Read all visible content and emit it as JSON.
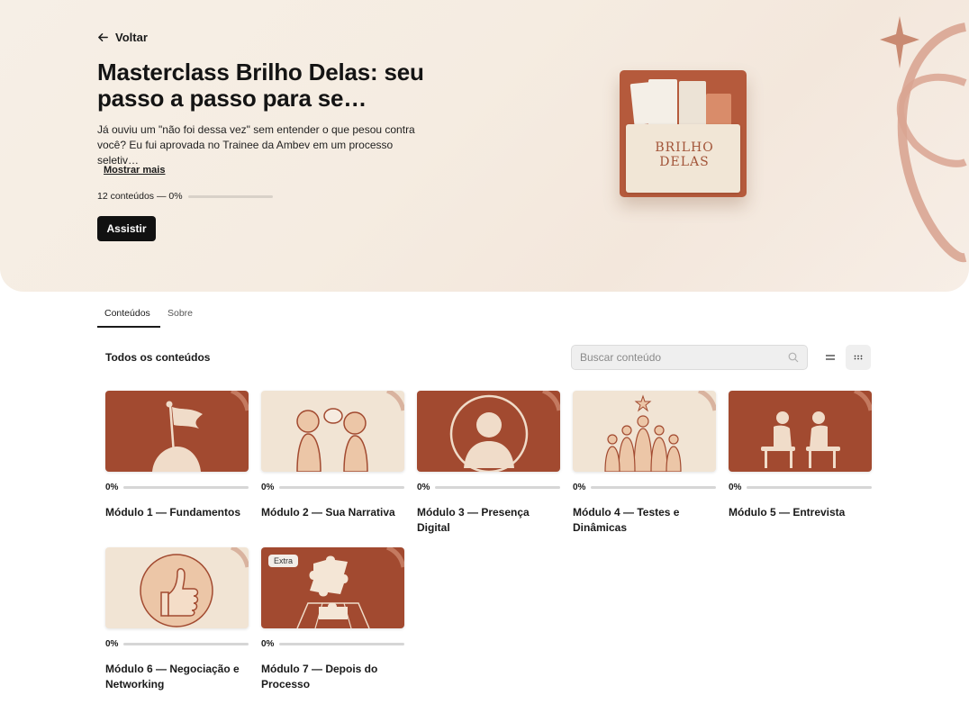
{
  "hero": {
    "back_label": "Voltar",
    "title": "Masterclass Brilho Delas: seu passo a passo para se…",
    "description": "Já ouviu um \"não foi dessa vez\" sem entender o que pesou contra você? Eu fui aprovada no Trainee da Ambev em um processo seletiv…",
    "show_more": "Mostrar mais",
    "progress_text": "12 conteúdos — 0%",
    "progress_value": 0,
    "watch_label": "Assistir",
    "cover_brand": "BRILHO DELAS"
  },
  "tabs": [
    {
      "label": "Conteúdos",
      "active": true
    },
    {
      "label": "Sobre",
      "active": false
    }
  ],
  "contents": {
    "section_title": "Todos os conteúdos",
    "search_placeholder": "Buscar conteúdo",
    "view_mode": "grid"
  },
  "modules": [
    {
      "title": "Módulo 1 — Fundamentos",
      "progress": "0%",
      "theme": "dark",
      "icon": "flag-on-rock-icon"
    },
    {
      "title": "Módulo 2 — Sua Narrativa",
      "progress": "0%",
      "theme": "light",
      "icon": "two-people-talking-icon"
    },
    {
      "title": "Módulo 3 — Presença Digital",
      "progress": "0%",
      "theme": "dark",
      "icon": "profile-avatar-icon"
    },
    {
      "title": "Módulo 4 — Testes e Dinâmicas",
      "progress": "0%",
      "theme": "light",
      "icon": "group-with-star-icon"
    },
    {
      "title": "Módulo 5 — Entrevista",
      "progress": "0%",
      "theme": "dark",
      "icon": "interview-chairs-icon"
    },
    {
      "title": "Módulo 6 — Negociação e Networking",
      "progress": "0%",
      "theme": "light",
      "icon": "thumbs-up-icon"
    },
    {
      "title": "Módulo 7 — Depois do Processo",
      "progress": "0%",
      "theme": "dark",
      "icon": "puzzle-pieces-icon",
      "badge": "Extra"
    }
  ],
  "colors": {
    "brand_terracotta": "#a24a30",
    "cream": "#f1e4d4",
    "button_dark": "#111111"
  }
}
